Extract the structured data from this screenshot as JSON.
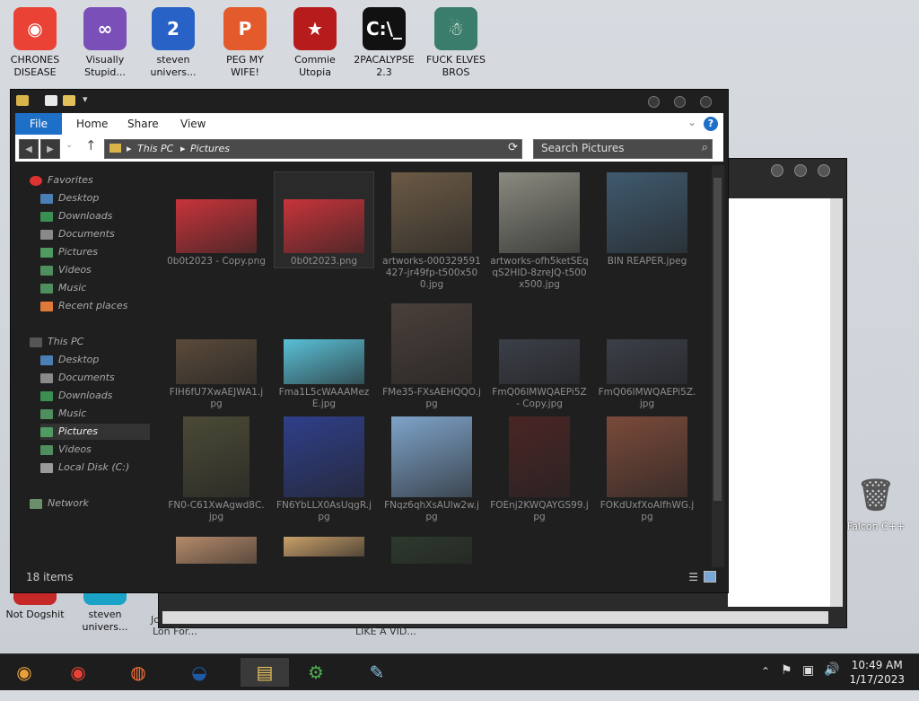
{
  "desktop": {
    "icons_top": [
      {
        "label": "CHRONES\nDISEASE",
        "glyph": "◉",
        "color": "#ea4335"
      },
      {
        "label": "Visually\nStupid...",
        "glyph": "∞",
        "color": "#7b4fb8"
      },
      {
        "label": "steven\nunivers...",
        "glyph": "2",
        "color": "#2862c7"
      },
      {
        "label": "PEG MY WIFE!",
        "glyph": "P",
        "color": "#e35b2c"
      },
      {
        "label": "Commie\nUtopia",
        "glyph": "★",
        "color": "#b71c1c"
      },
      {
        "label": "2PACALYPSE\n2.3",
        "glyph": "C:\\_",
        "color": "#111111"
      },
      {
        "label": "FUCK ELVES\nBROS",
        "glyph": "☃",
        "color": "#3a7d6a"
      }
    ],
    "icons_bottom": [
      {
        "label": "Not Dogshit",
        "glyph": "C++",
        "color": "#c62828"
      },
      {
        "label": "steven\nunivers...",
        "glyph": "V",
        "color": "#1aa3c7"
      }
    ],
    "recycle": {
      "label": "Falcon C++"
    },
    "behind_text": {
      "a": "Jo",
      "b": "Lon For...",
      "c": "LIKE A VID..."
    }
  },
  "explorer": {
    "ribbon": {
      "file": "File",
      "home": "Home",
      "share": "Share",
      "view": "View",
      "help": "?"
    },
    "address": {
      "root": "This PC",
      "folder": "Pictures",
      "sep": "▸"
    },
    "search_placeholder": "Search Pictures",
    "sidebar": {
      "favorites": "Favorites",
      "fav_items": [
        "Desktop",
        "Downloads",
        "Documents",
        "Pictures",
        "Videos",
        "Music",
        "Recent places"
      ],
      "thispc": "This PC",
      "pc_items": [
        "Desktop",
        "Documents",
        "Downloads",
        "Music",
        "Pictures",
        "Videos",
        "Local Disk (C:)"
      ],
      "network": "Network"
    },
    "files": [
      {
        "name": "0b0t2023 - Copy.png",
        "color": "#c7343a"
      },
      {
        "name": "0b0t2023.png",
        "color": "#c7343a"
      },
      {
        "name": "artworks-000329591427-jr49fp-t500x500.jpg",
        "color": "#6b5a45"
      },
      {
        "name": "artworks-ofh5ketSEqqS2HID-8zreJQ-t500x500.jpg",
        "color": "#8a8a80"
      },
      {
        "name": "BIN REAPER.jpeg",
        "color": "#3f5a6e"
      },
      {
        "name": "FIH6fU7XwAEJWA1.jpg",
        "color": "#5a4a3a"
      },
      {
        "name": "Fma1L5cWAAAMezE.jpg",
        "color": "#5ac0d6"
      },
      {
        "name": "FMe35-FXsAEHQQO.jpg",
        "color": "#4a3f3a"
      },
      {
        "name": "FmQ06IMWQAEPi5Z - Copy.jpg",
        "color": "#3b3f48"
      },
      {
        "name": "FmQ06IMWQAEPi5Z.jpg",
        "color": "#3b3f48"
      },
      {
        "name": "FN0-C61XwAgwd8C.jpg",
        "color": "#4b4a36"
      },
      {
        "name": "FN6YbLLX0AsUqgR.jpg",
        "color": "#2f3f8a"
      },
      {
        "name": "FNqz6qhXsAUIw2w.jpg",
        "color": "#7ea3c9"
      },
      {
        "name": "FOEnj2KWQAYGS99.jpg",
        "color": "#4a2525"
      },
      {
        "name": "FOKdUxfXoAIfhWG.jpg",
        "color": "#7a4a3a"
      },
      {
        "name": "",
        "color": "#b48a6a"
      },
      {
        "name": "",
        "color": "#c9a06a"
      },
      {
        "name": "",
        "color": "#2e3a2e"
      }
    ],
    "status": {
      "count": "18 items"
    }
  },
  "taskbar": {
    "apps": [
      {
        "name": "chrome-alt",
        "glyph": "◉",
        "color": "#e9a03b"
      },
      {
        "name": "chrome",
        "glyph": "◉",
        "color": "#ea4335"
      },
      {
        "name": "firefox",
        "glyph": "◍",
        "color": "#ff7139"
      },
      {
        "name": "obama",
        "glyph": "◒",
        "color": "#1e5aa8"
      },
      {
        "name": "file-explorer",
        "glyph": "▤",
        "color": "#e8c35a"
      },
      {
        "name": "network-app",
        "glyph": "⚙",
        "color": "#4caf50"
      },
      {
        "name": "notepad",
        "glyph": "✎",
        "color": "#8ec5e8"
      }
    ],
    "time": "10:49 AM",
    "date": "1/17/2023"
  }
}
